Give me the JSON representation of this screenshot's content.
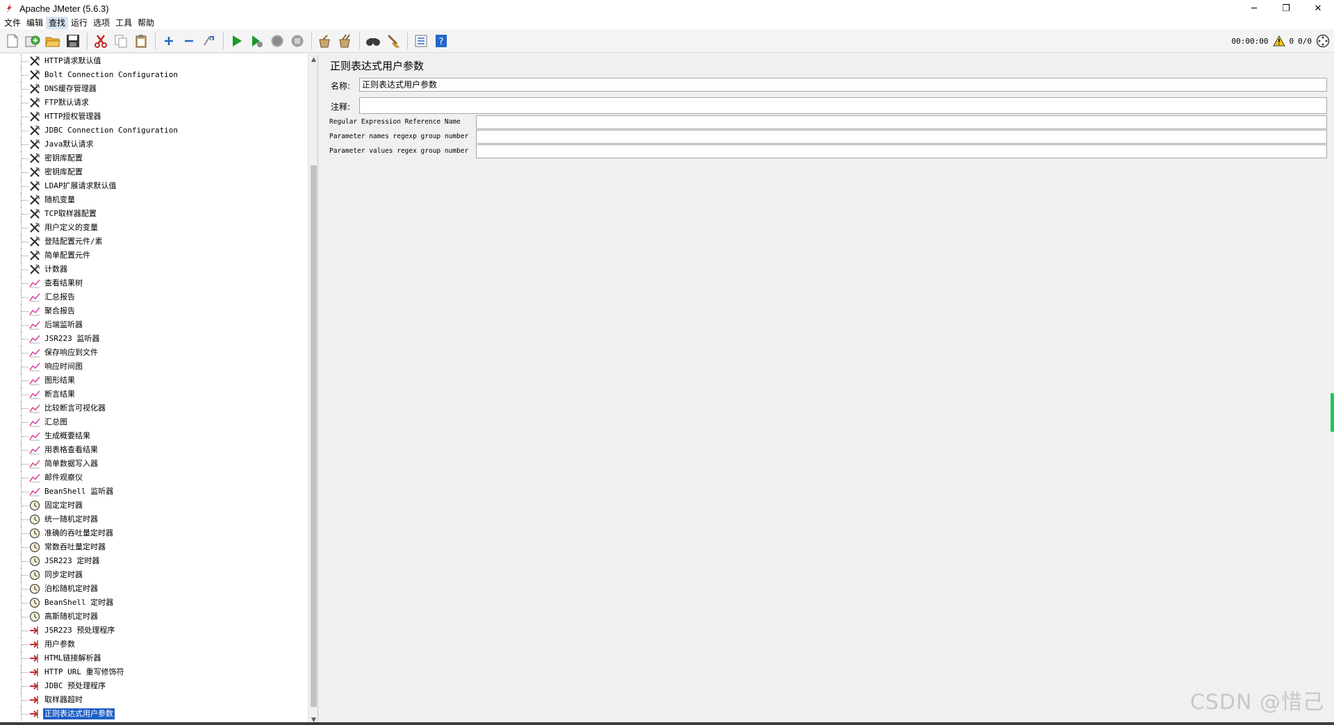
{
  "window": {
    "title": "Apache JMeter (5.6.3)",
    "minimize": "─",
    "maximize": "❐",
    "close": "✕"
  },
  "menu": [
    "文件",
    "编辑",
    "查找",
    "运行",
    "选项",
    "工具",
    "帮助"
  ],
  "menu_active_index": 2,
  "toolbar": {
    "icons": [
      "new-icon",
      "templates-icon",
      "open-icon",
      "save-icon",
      "cut-icon",
      "copy-icon",
      "paste-icon",
      "expand-icon",
      "collapse-icon",
      "toggle-icon",
      "start-icon",
      "start-no-pause-icon",
      "stop-icon",
      "shutdown-icon",
      "clear-icon",
      "clear-all-icon",
      "search-icon",
      "reset-search-icon",
      "function-helper-icon",
      "help-icon"
    ],
    "timer": "00:00:00",
    "warnings": "0",
    "threads": "0/0"
  },
  "tree": {
    "items": [
      {
        "label": "HTTP请求默认值",
        "icon": "config-element-icon"
      },
      {
        "label": "Bolt Connection Configuration",
        "icon": "config-element-icon"
      },
      {
        "label": "DNS缓存管理器",
        "icon": "config-element-icon"
      },
      {
        "label": "FTP默认请求",
        "icon": "config-element-icon"
      },
      {
        "label": "HTTP授权管理器",
        "icon": "config-element-icon"
      },
      {
        "label": "JDBC Connection Configuration",
        "icon": "config-element-icon"
      },
      {
        "label": "Java默认请求",
        "icon": "config-element-icon"
      },
      {
        "label": "密钥库配置",
        "icon": "config-element-icon"
      },
      {
        "label": "密钥库配置",
        "icon": "config-element-icon"
      },
      {
        "label": "LDAP扩展请求默认值",
        "icon": "config-element-icon"
      },
      {
        "label": "随机变量",
        "icon": "config-element-icon"
      },
      {
        "label": "TCP取样器配置",
        "icon": "config-element-icon"
      },
      {
        "label": "用户定义的变量",
        "icon": "config-element-icon"
      },
      {
        "label": "登陆配置元件/素",
        "icon": "config-element-icon"
      },
      {
        "label": "简单配置元件",
        "icon": "config-element-icon"
      },
      {
        "label": "计数器",
        "icon": "config-element-icon"
      },
      {
        "label": "查看结果树",
        "icon": "listener-icon"
      },
      {
        "label": "汇总报告",
        "icon": "listener-icon"
      },
      {
        "label": "聚合报告",
        "icon": "listener-icon"
      },
      {
        "label": "后端监听器",
        "icon": "listener-icon"
      },
      {
        "label": "JSR223 监听器",
        "icon": "listener-icon"
      },
      {
        "label": "保存响应到文件",
        "icon": "listener-icon"
      },
      {
        "label": "响应时间图",
        "icon": "listener-icon"
      },
      {
        "label": "图形结果",
        "icon": "listener-icon"
      },
      {
        "label": "断言结果",
        "icon": "listener-icon"
      },
      {
        "label": "比较断言可视化器",
        "icon": "listener-icon"
      },
      {
        "label": "汇总图",
        "icon": "listener-icon"
      },
      {
        "label": "生成概要结果",
        "icon": "listener-icon"
      },
      {
        "label": "用表格查看结果",
        "icon": "listener-icon"
      },
      {
        "label": "简单数据写入器",
        "icon": "listener-icon"
      },
      {
        "label": "邮件观察仪",
        "icon": "listener-icon"
      },
      {
        "label": "BeanShell 监听器",
        "icon": "listener-icon"
      },
      {
        "label": "固定定时器",
        "icon": "timer-icon"
      },
      {
        "label": "统一随机定时器",
        "icon": "timer-icon"
      },
      {
        "label": "准确的吞吐量定时器",
        "icon": "timer-icon"
      },
      {
        "label": "常数吞吐量定时器",
        "icon": "timer-icon"
      },
      {
        "label": "JSR223 定时器",
        "icon": "timer-icon"
      },
      {
        "label": "同步定时器",
        "icon": "timer-icon"
      },
      {
        "label": "泊松随机定时器",
        "icon": "timer-icon"
      },
      {
        "label": "BeanShell 定时器",
        "icon": "timer-icon"
      },
      {
        "label": "高斯随机定时器",
        "icon": "timer-icon"
      },
      {
        "label": "JSR223 预处理程序",
        "icon": "preprocessor-icon"
      },
      {
        "label": "用户参数",
        "icon": "preprocessor-icon"
      },
      {
        "label": "HTML链接解析器",
        "icon": "preprocessor-icon"
      },
      {
        "label": "HTTP URL 重写修饰符",
        "icon": "preprocessor-icon"
      },
      {
        "label": "JDBC 预处理程序",
        "icon": "preprocessor-icon"
      },
      {
        "label": "取样器超时",
        "icon": "preprocessor-icon"
      },
      {
        "label": "正则表达式用户参数",
        "icon": "preprocessor-icon",
        "selected": true
      }
    ]
  },
  "form": {
    "title": "正则表达式用户参数",
    "name_label": "名称:",
    "name_value": "正则表达式用户参数",
    "comment_label": "注释:",
    "comment_value": "",
    "params": [
      {
        "label": "Regular Expression Reference Name",
        "value": ""
      },
      {
        "label": "Parameter names regexp group number",
        "value": ""
      },
      {
        "label": "Parameter values regex group number",
        "value": ""
      }
    ]
  },
  "watermark": "CSDN @惜己",
  "colors": {
    "selection": "#1e5fc8",
    "start_green": "#1a9a2a",
    "cut_red": "#c62828",
    "indicator_green": "#22c55e"
  }
}
